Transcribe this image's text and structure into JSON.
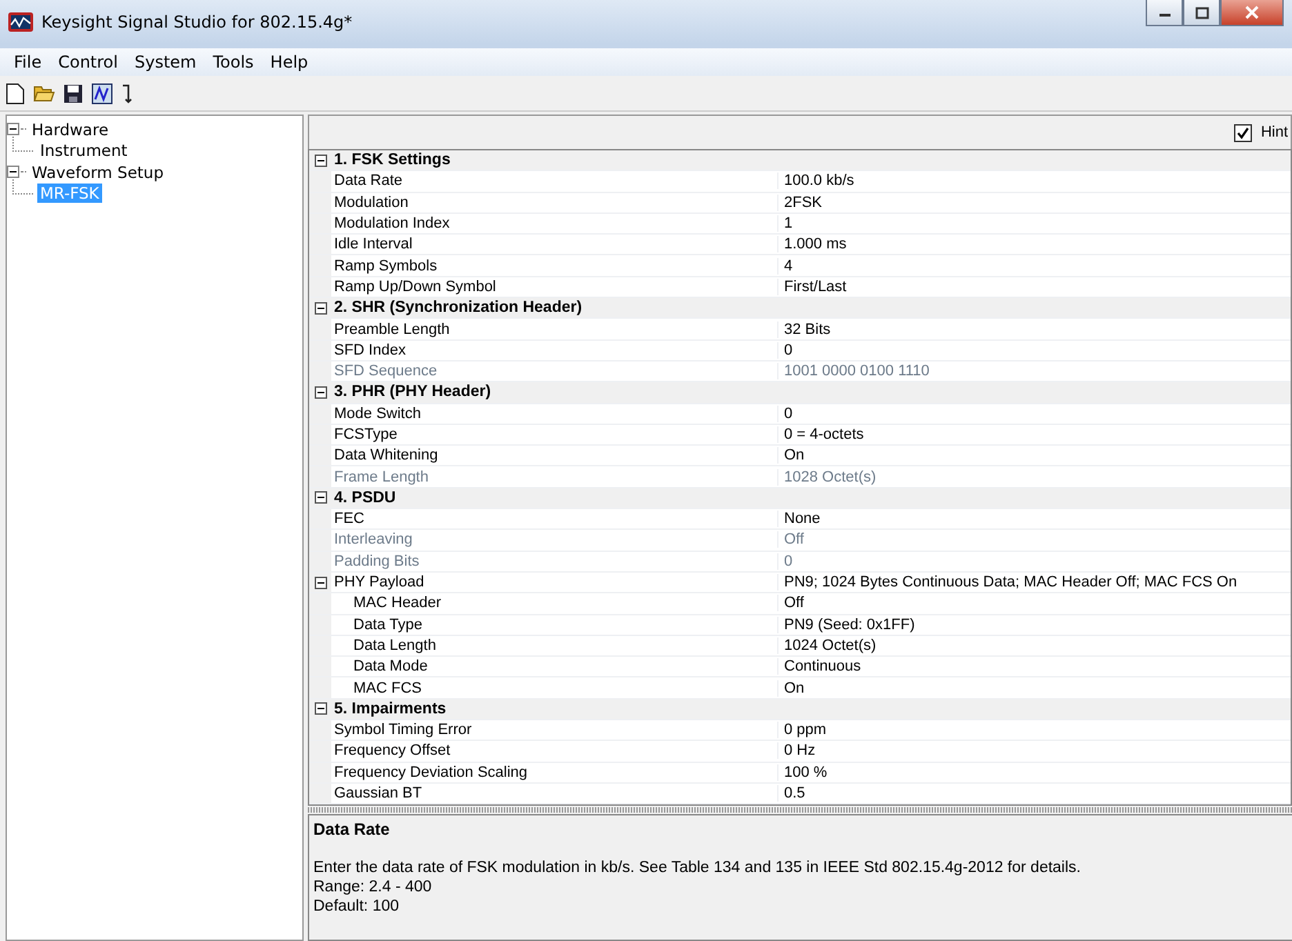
{
  "window": {
    "title": "Keysight Signal Studio for 802.15.4g*"
  },
  "menu": [
    "File",
    "Control",
    "System",
    "Tools",
    "Help"
  ],
  "tree": [
    {
      "label": "Hardware",
      "expanded": true,
      "selected": false,
      "children": [
        {
          "label": "Instrument",
          "selected": false
        }
      ]
    },
    {
      "label": "Waveform Setup",
      "expanded": true,
      "selected": false,
      "children": [
        {
          "label": "MR-FSK",
          "selected": true
        }
      ]
    }
  ],
  "hint": {
    "label": "Hint",
    "checked": true
  },
  "sections": [
    {
      "title": "1. FSK Settings",
      "expanded": true,
      "properties": [
        {
          "label": "Data Rate",
          "value": "100.0 kb/s",
          "disabled": false
        },
        {
          "label": "Modulation",
          "value": "2FSK",
          "disabled": false
        },
        {
          "label": "Modulation Index",
          "value": "1",
          "disabled": false
        },
        {
          "label": "Idle Interval",
          "value": "1.000 ms",
          "disabled": false
        },
        {
          "label": "Ramp Symbols",
          "value": "4",
          "disabled": false
        },
        {
          "label": "Ramp Up/Down Symbol",
          "value": "First/Last",
          "disabled": false
        }
      ]
    },
    {
      "title": "2. SHR (Synchronization Header)",
      "expanded": true,
      "properties": [
        {
          "label": "Preamble Length",
          "value": "32 Bits",
          "disabled": false
        },
        {
          "label": "SFD Index",
          "value": "0",
          "disabled": false
        },
        {
          "label": "SFD Sequence",
          "value": "1001 0000 0100 1110",
          "disabled": true
        }
      ]
    },
    {
      "title": "3. PHR (PHY Header)",
      "expanded": true,
      "properties": [
        {
          "label": "Mode Switch",
          "value": "0",
          "disabled": false
        },
        {
          "label": "FCSType",
          "value": "0 = 4-octets",
          "disabled": false
        },
        {
          "label": "Data Whitening",
          "value": "On",
          "disabled": false
        },
        {
          "label": "Frame Length",
          "value": "1028 Octet(s)",
          "disabled": true
        }
      ]
    },
    {
      "title": "4. PSDU",
      "expanded": true,
      "properties": [
        {
          "label": "FEC",
          "value": "None",
          "disabled": false
        },
        {
          "label": "Interleaving",
          "value": "Off",
          "disabled": true
        },
        {
          "label": "Padding Bits",
          "value": "0",
          "disabled": true
        },
        {
          "label": "PHY Payload",
          "value": "PN9; 1024 Bytes Continuous Data; MAC Header Off; MAC FCS On",
          "disabled": false,
          "expanded": true,
          "children": [
            {
              "label": "MAC Header",
              "value": "Off",
              "disabled": false
            },
            {
              "label": "Data Type",
              "value": "PN9 (Seed: 0x1FF)",
              "disabled": false
            },
            {
              "label": "Data Length",
              "value": "1024 Octet(s)",
              "disabled": false
            },
            {
              "label": "Data Mode",
              "value": "Continuous",
              "disabled": false
            },
            {
              "label": "MAC FCS",
              "value": "On",
              "disabled": false
            }
          ]
        }
      ]
    },
    {
      "title": "5. Impairments",
      "expanded": true,
      "properties": [
        {
          "label": "Symbol Timing Error",
          "value": "0 ppm",
          "disabled": false
        },
        {
          "label": "Frequency Offset",
          "value": "0 Hz",
          "disabled": false
        },
        {
          "label": "Frequency Deviation Scaling",
          "value": "100 %",
          "disabled": false
        },
        {
          "label": "Gaussian BT",
          "value": "0.5",
          "disabled": false
        }
      ]
    }
  ],
  "help": {
    "title": "Data Rate",
    "lines": [
      "Enter the data rate of FSK modulation in kb/s. See Table 134 and 135 in IEEE Std 802.15.4g-2012 for details.",
      "Range: 2.4 - 400",
      "Default: 100"
    ]
  }
}
